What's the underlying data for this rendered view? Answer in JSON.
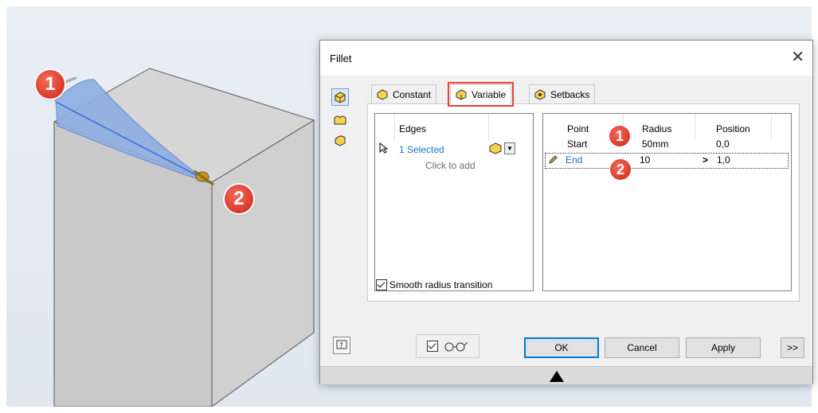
{
  "dialog": {
    "title": "Fillet",
    "close_glyph": "✕",
    "tabs": [
      {
        "label": "Constant",
        "icon": "constant-fillet-icon"
      },
      {
        "label": "Variable",
        "icon": "variable-fillet-icon",
        "active": true
      },
      {
        "label": "Setbacks",
        "icon": "setback-fillet-icon"
      }
    ],
    "side_modes": [
      "edge-fillet-icon",
      "face-fillet-icon",
      "full-round-fillet-icon"
    ],
    "edges": {
      "header": "Edges",
      "selected_label": "1 Selected",
      "add_hint": "Click to add"
    },
    "points_table": {
      "columns": [
        "Point",
        "Radius",
        "Position"
      ],
      "rows": [
        {
          "point": "Start",
          "radius": "50mm",
          "position": "0,0",
          "marker": "1"
        },
        {
          "point": "End",
          "radius": "10",
          "position": "1,0",
          "marker": "2"
        }
      ],
      "more_glyph": ">"
    },
    "smooth_transition": {
      "label": "Smooth radius transition",
      "checked": true
    },
    "preview_checked": true,
    "buttons": {
      "ok": "OK",
      "cancel": "Cancel",
      "apply": "Apply",
      "more": ">>"
    }
  },
  "viewport_markers": [
    "1",
    "2"
  ],
  "colors": {
    "accent_blue": "#1a6fd1",
    "highlight_red": "#e34234",
    "marker_red": "#d93a2b"
  }
}
